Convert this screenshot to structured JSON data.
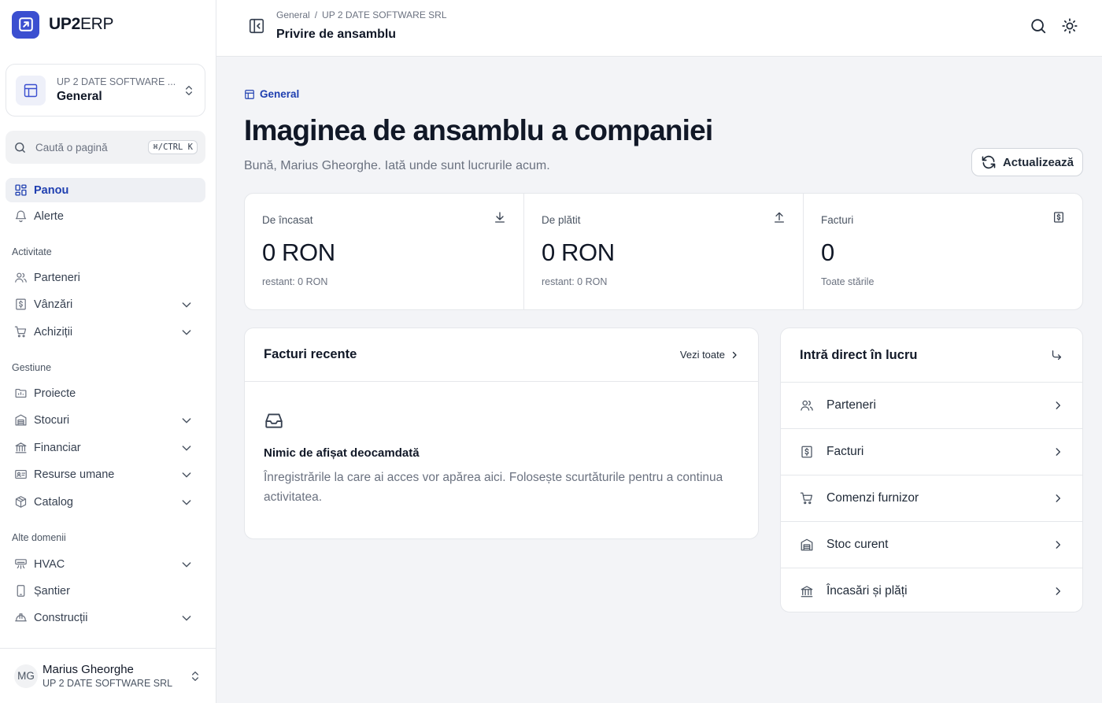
{
  "brand": {
    "bold": "UP2",
    "light": "ERP"
  },
  "org": {
    "company": "UP 2 DATE SOFTWARE ...",
    "name": "General"
  },
  "search": {
    "placeholder": "Caută o pagină",
    "shortcut": "⌘/CTRL K"
  },
  "nav": {
    "top": [
      {
        "label": "Panou"
      },
      {
        "label": "Alerte"
      }
    ],
    "sections": [
      {
        "title": "Activitate",
        "items": [
          {
            "label": "Parteneri"
          },
          {
            "label": "Vânzări"
          },
          {
            "label": "Achiziții"
          }
        ]
      },
      {
        "title": "Gestiune",
        "items": [
          {
            "label": "Proiecte"
          },
          {
            "label": "Stocuri"
          },
          {
            "label": "Financiar"
          },
          {
            "label": "Resurse umane"
          },
          {
            "label": "Catalog"
          }
        ]
      },
      {
        "title": "Alte domenii",
        "items": [
          {
            "label": "HVAC"
          },
          {
            "label": "Șantier"
          },
          {
            "label": "Construcții"
          }
        ]
      }
    ]
  },
  "profile": {
    "initials": "MG",
    "name": "Marius Gheorghe",
    "company": "UP 2 DATE SOFTWARE SRL"
  },
  "header": {
    "breadcrumb": [
      "General",
      "/",
      "UP 2 DATE SOFTWARE SRL"
    ],
    "title": "Privire de ansamblu"
  },
  "main": {
    "section": "General",
    "heading": "Imaginea de ansamblu a companiei",
    "subheading": "Bună, Marius Gheorghe. Iată unde sunt lucrurile acum.",
    "refresh_label": "Actualizează",
    "stats": [
      {
        "label": "De încasat",
        "value": "0 RON",
        "sub": "restant: 0 RON",
        "icon": "download-icon"
      },
      {
        "label": "De plătit",
        "value": "0 RON",
        "sub": "restant: 0 RON",
        "icon": "upload-icon"
      },
      {
        "label": "Facturi",
        "value": "0",
        "sub": "Toate stările",
        "icon": "invoice-icon"
      }
    ],
    "recent": {
      "title": "Facturi recente",
      "see_all": "Vezi toate",
      "empty_title": "Nimic de afișat deocamdată",
      "empty_text": "Înregistrările la care ai acces vor apărea aici. Folosește scurtăturile pentru a continua activitatea."
    },
    "quick": {
      "title": "Intră direct în lucru",
      "items": [
        {
          "label": "Parteneri",
          "icon": "users-icon"
        },
        {
          "label": "Facturi",
          "icon": "invoice-icon"
        },
        {
          "label": "Comenzi furnizor",
          "icon": "cart-icon"
        },
        {
          "label": "Stoc curent",
          "icon": "warehouse-icon"
        },
        {
          "label": "Încasări și plăți",
          "icon": "bank-icon"
        }
      ]
    }
  },
  "colors": {
    "accent": "#1f3fb0",
    "brand": "#3b4fd0",
    "background": "#f3f4f7"
  }
}
